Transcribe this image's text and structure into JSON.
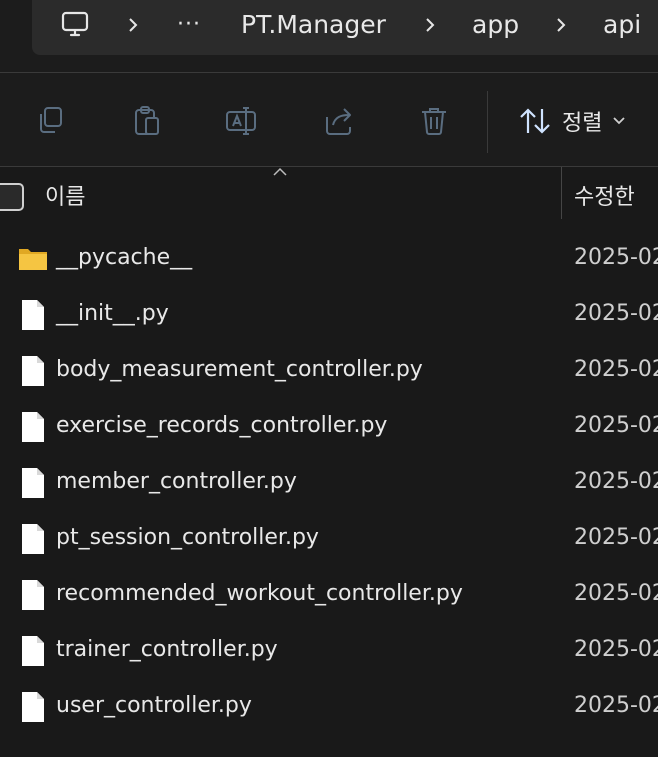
{
  "breadcrumb": {
    "items": [
      {
        "label": "PT.Manager"
      },
      {
        "label": "app"
      },
      {
        "label": "api"
      }
    ],
    "overflow": "···"
  },
  "toolbar": {
    "sort_label": "정렬"
  },
  "columns": {
    "name": "이름",
    "modified": "수정한 "
  },
  "files": [
    {
      "name": "__pycache__",
      "type": "folder",
      "date": "2025-02"
    },
    {
      "name": "__init__.py",
      "type": "file",
      "date": "2025-02"
    },
    {
      "name": "body_measurement_controller.py",
      "type": "file",
      "date": "2025-02"
    },
    {
      "name": "exercise_records_controller.py",
      "type": "file",
      "date": "2025-02"
    },
    {
      "name": "member_controller.py",
      "type": "file",
      "date": "2025-02"
    },
    {
      "name": "pt_session_controller.py",
      "type": "file",
      "date": "2025-02"
    },
    {
      "name": "recommended_workout_controller.py",
      "type": "file",
      "date": "2025-02"
    },
    {
      "name": "trainer_controller.py",
      "type": "file",
      "date": "2025-02"
    },
    {
      "name": "user_controller.py",
      "type": "file",
      "date": "2025-02"
    }
  ],
  "colors": {
    "background": "#191919",
    "folder": "#f5c542",
    "toolbar_icon": "#5a6d80",
    "sort_icon": "#cfe3ff"
  }
}
